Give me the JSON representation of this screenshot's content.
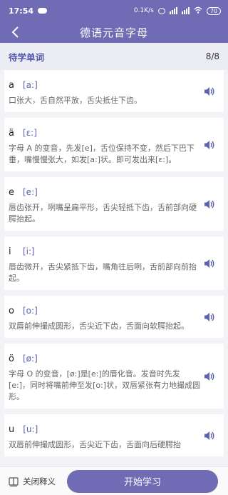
{
  "status": {
    "time": "17:54",
    "speed": "0.1K/s",
    "battery": "70"
  },
  "header": {
    "title": "德语元音字母"
  },
  "section": {
    "title": "待学单词",
    "counter": "8/8"
  },
  "items": [
    {
      "letter": "a",
      "ipa": "[a:]",
      "desc": "口张大，舌自然平放，舌尖抵住下齿。"
    },
    {
      "letter": "ä",
      "ipa": "[ɛ:]",
      "desc": "字母 A 的变音，先发[e]，舌位保持不变，然后下巴下垂，嘴慢慢张大，如发[a:]状。即可发出来[ɛ:]。"
    },
    {
      "letter": "e",
      "ipa": "[e:]",
      "desc": "唇齿张开，咧嘴呈扁平形，舌尖轻抵下齿，舌前部向硬腭抬起。"
    },
    {
      "letter": "i",
      "ipa": "[i:]",
      "desc": "唇齿微开，舌尖紧抵下齿，嘴角往后咧，舌前部向前抬起。"
    },
    {
      "letter": "o",
      "ipa": "[o:]",
      "desc": "双唇前伸撮成圆形，舌尖近下齿，舌面向软腭抬起。"
    },
    {
      "letter": "ö",
      "ipa": "[ø:]",
      "desc": "字母 O 的变音，[ø:]是[e:]的唇化音。发音时先发[e:]，同时将嘴前伸至发[o:]状，双唇紧张有力地撮成圆形。"
    },
    {
      "letter": "u",
      "ipa": "[u:]",
      "desc": "双唇前伸撮成圆形，舌尖近下齿，舌面向后硬腭抬"
    }
  ],
  "footer": {
    "toggle_label": "关闭释义",
    "start_label": "开始学习"
  },
  "colors": {
    "primary": "#6f6bb4",
    "accent": "#5b62b0"
  }
}
